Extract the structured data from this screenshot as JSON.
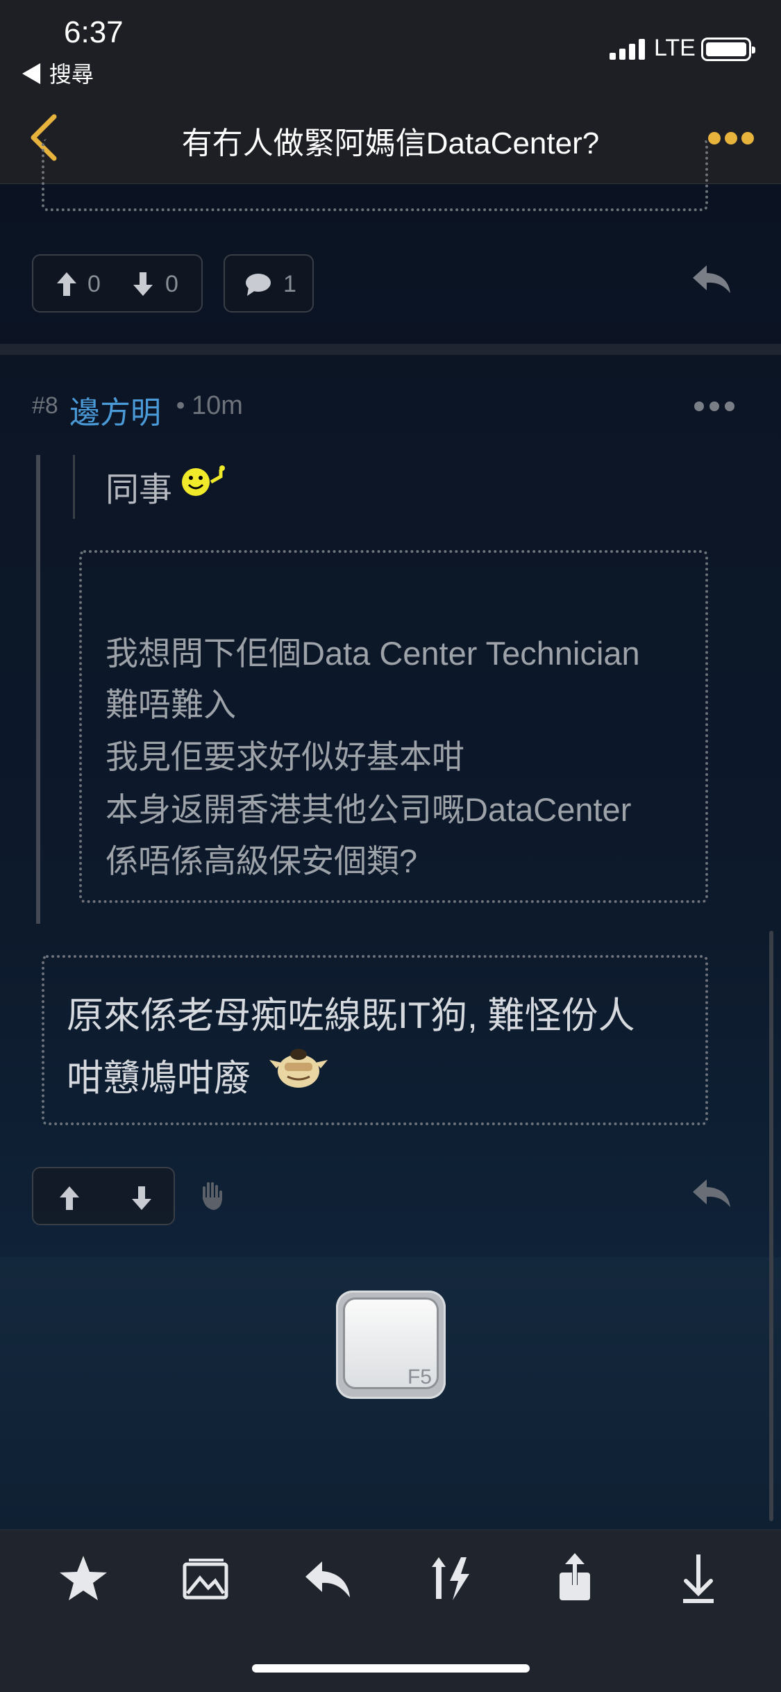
{
  "status_bar": {
    "time": "6:37",
    "back_app": "◀ 搜尋",
    "network": "LTE"
  },
  "nav": {
    "title": "有冇人做緊阿媽信DataCenter?"
  },
  "prev_post": {
    "upvotes": "0",
    "downvotes": "0",
    "replies": "1"
  },
  "post": {
    "number": "#8",
    "username": "邊方明",
    "separator": "•",
    "time": "10m",
    "outer_quote": "同事",
    "inner_quote_lines": [
      "我想問下佢個Data Center Technician",
      "難唔難入",
      "我見佢要求好似好基本咁",
      "本身返開香港其他公司嘅DataCenter",
      "係唔係高級保安個類?"
    ],
    "reply_lines": [
      "原來係老母痴咗線既IT狗, 難怪份人",
      "咁戇鳩咁廢"
    ]
  },
  "refresh": {
    "key_label": "F5"
  },
  "toolbar": {
    "items": [
      "star-icon",
      "image-icon",
      "reply-icon",
      "sort-icon",
      "share-icon",
      "download-icon"
    ]
  },
  "colors": {
    "accent": "#e7b33c",
    "username": "#4b9ad8",
    "background": "#0b1322"
  }
}
